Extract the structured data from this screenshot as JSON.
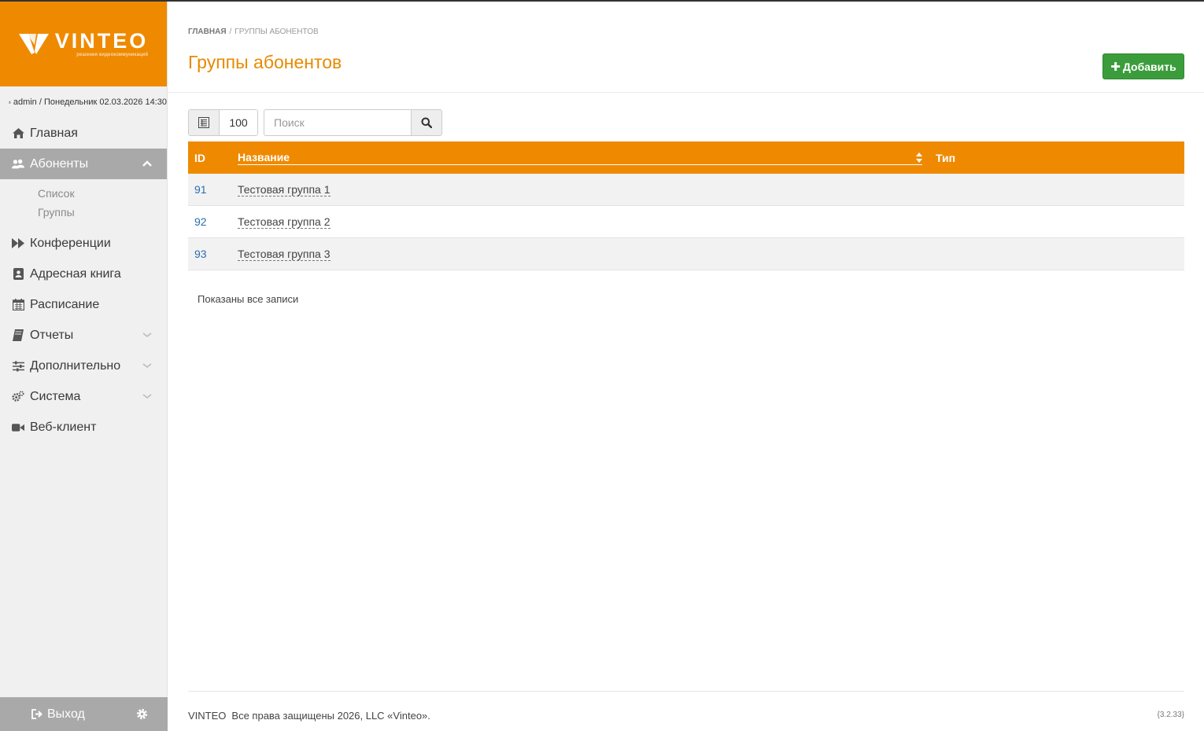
{
  "brand": {
    "name": "VINTEO",
    "tagline": "решения видеокоммуникаций",
    "accent_color": "#ef8a00"
  },
  "user_line": "admin / Понедельник 02.03.2026 14:30",
  "sidebar": {
    "items": [
      {
        "label": "Главная",
        "icon": "home-icon"
      },
      {
        "label": "Абоненты",
        "icon": "users-icon",
        "active": true,
        "expanded": true,
        "children": [
          {
            "label": "Список"
          },
          {
            "label": "Группы"
          }
        ]
      },
      {
        "label": "Конференции",
        "icon": "fast-forward-icon"
      },
      {
        "label": "Адресная книга",
        "icon": "address-book-icon"
      },
      {
        "label": "Расписание",
        "icon": "calendar-icon"
      },
      {
        "label": "Отчеты",
        "icon": "book-icon",
        "has_submenu": true
      },
      {
        "label": "Дополнительно",
        "icon": "sliders-icon",
        "has_submenu": true
      },
      {
        "label": "Система",
        "icon": "cogs-icon",
        "has_submenu": true
      },
      {
        "label": "Веб-клиент",
        "icon": "video-camera-icon"
      }
    ],
    "logout_label": "Выход"
  },
  "breadcrumb": {
    "home": "Главная",
    "separator": "/",
    "current": "Группы абонентов"
  },
  "page_title": "Группы абонентов",
  "add_button_label": "Добавить",
  "toolbar": {
    "page_size": "100",
    "search_placeholder": "Поиск"
  },
  "table": {
    "columns": [
      "ID",
      "Название",
      "Тип"
    ],
    "rows": [
      {
        "id": "91",
        "name": "Тестовая группа 1",
        "type": ""
      },
      {
        "id": "92",
        "name": "Тестовая группа 2",
        "type": ""
      },
      {
        "id": "93",
        "name": "Тестовая группа 3",
        "type": ""
      }
    ]
  },
  "records_info": "Показаны все записи",
  "footer": {
    "brand": "VINTEO",
    "copyright": "Все права защищены 2026, LLC «Vinteo».",
    "version": "{3.2.33}"
  }
}
